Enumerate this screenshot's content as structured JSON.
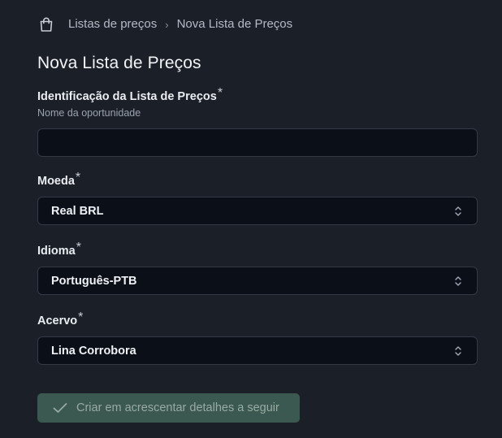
{
  "breadcrumb": {
    "icon": "shopping-bag-icon",
    "items": [
      {
        "label": "Listas de preços"
      },
      {
        "label": "Nova Lista de Preços"
      }
    ],
    "separator": "›"
  },
  "page": {
    "title": "Nova Lista de Preços"
  },
  "form": {
    "identification": {
      "label": "Identificação da Lista de Preços",
      "required_mark": "*",
      "hint": "Nome da oportunidade",
      "value": ""
    },
    "currency": {
      "label": "Moeda",
      "required_mark": "*",
      "value": "Real BRL"
    },
    "language": {
      "label": "Idioma",
      "required_mark": "*",
      "value": "Português-PTB"
    },
    "collection": {
      "label": "Acervo",
      "required_mark": "*",
      "value": "Lina Corrobora"
    },
    "submit": {
      "label": "Criar em acrescentar detalhes a seguir",
      "icon": "check-icon"
    }
  },
  "colors": {
    "background": "#1b1f27",
    "field_background": "#0b0f17",
    "field_border": "#333a46",
    "submit_background": "#3b5951",
    "submit_text": "#97aaa3"
  }
}
